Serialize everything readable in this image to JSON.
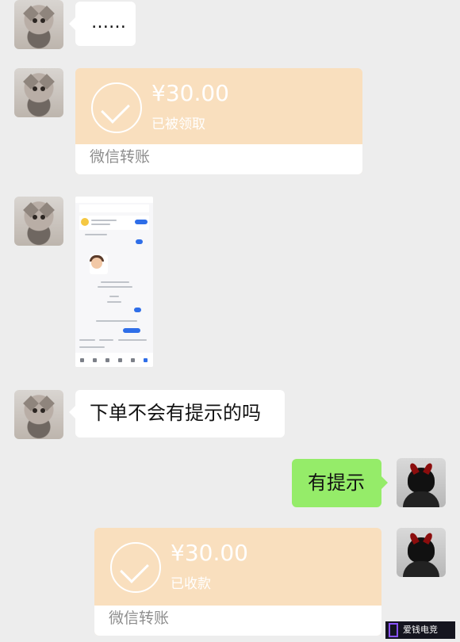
{
  "messages": {
    "m1_text": "……",
    "m2_amount": "¥30.00",
    "m2_status": "已被领取",
    "m2_label": "微信转账",
    "m4_text": "下单不会有提示的吗",
    "m5_text": "有提示",
    "m6_amount": "¥30.00",
    "m6_status": "已收款",
    "m6_label": "微信转账"
  },
  "watermark": {
    "text": "爱钱电竞"
  },
  "colors": {
    "background": "#ededed",
    "incoming_bubble": "#ffffff",
    "outgoing_bubble": "#95ec69",
    "transfer_card": "#f9dfbe"
  }
}
